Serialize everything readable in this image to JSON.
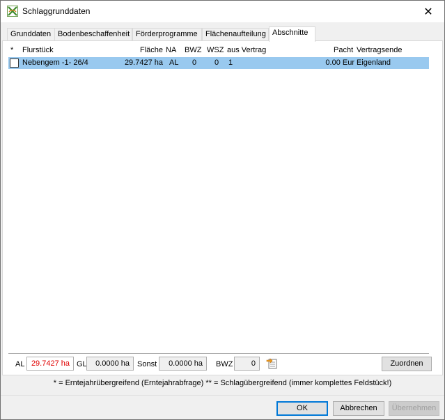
{
  "window": {
    "title": "Schlaggrunddaten",
    "close_symbol": "✕"
  },
  "tabs": [
    {
      "label": "Grunddaten"
    },
    {
      "label": "Bodenbeschaffenheit"
    },
    {
      "label": "Förderprogramme"
    },
    {
      "label": "Flächenaufteilung"
    },
    {
      "label": "Abschnitte"
    }
  ],
  "active_tab": "Abschnitte",
  "table": {
    "columns": {
      "star": "*",
      "flurstueck": "Flurstück",
      "flaeche": "Fläche",
      "na": "NA",
      "bwz": "BWZ",
      "wsz": "WSZ",
      "aus_vertrag": "aus Vertrag",
      "pacht": "Pacht",
      "vertragsende": "Vertragsende"
    },
    "rows": [
      {
        "checked": false,
        "flurstueck": "Nebengem -1- 26/4",
        "flaeche": "29.7427 ha",
        "na": "AL",
        "bwz": "0",
        "wsz": "0",
        "aus_vertrag": "1",
        "pacht": "0.00 Eur",
        "vertragsende": "Eigenland"
      }
    ]
  },
  "summary": {
    "al_label": "AL",
    "al_value": "29.7427 ha",
    "gl_label": "GL",
    "gl_value": "0.0000 ha",
    "sonst_label": "Sonst",
    "sonst_value": "0.0000 ha",
    "bwz_label": "BWZ",
    "bwz_value": "0",
    "assign_button": "Zuordnen"
  },
  "note": "* = Erntejahrübergreifend (Erntejahrabfrage)   ** = Schlagübergreifend (immer komplettes Feldstück!)",
  "buttons": {
    "ok": "OK",
    "cancel": "Abbrechen",
    "apply": "Übernehmen"
  },
  "colors": {
    "selection": "#99c9ef",
    "warning_text": "#e00000",
    "focus_border": "#0078d7"
  }
}
